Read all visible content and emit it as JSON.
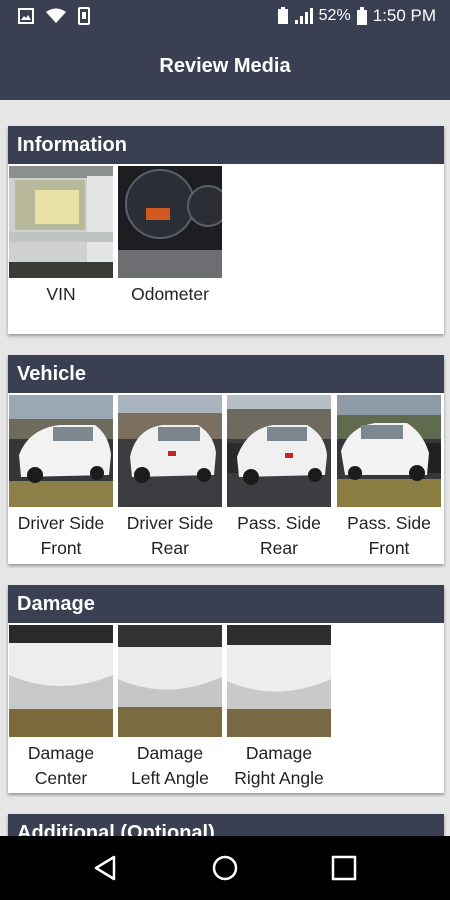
{
  "status_bar": {
    "battery": "52%",
    "time": "1:50 PM"
  },
  "app_bar": {
    "title": "Review Media"
  },
  "sections": [
    {
      "title": "Information",
      "items": [
        {
          "line1": "VIN",
          "line2": ""
        },
        {
          "line1": "Odometer",
          "line2": ""
        }
      ]
    },
    {
      "title": "Vehicle",
      "items": [
        {
          "line1": "Driver Side",
          "line2": "Front"
        },
        {
          "line1": "Driver Side",
          "line2": "Rear"
        },
        {
          "line1": "Pass. Side",
          "line2": "Rear"
        },
        {
          "line1": "Pass. Side",
          "line2": "Front"
        }
      ]
    },
    {
      "title": "Damage",
      "items": [
        {
          "line1": "Damage",
          "line2": "Center"
        },
        {
          "line1": "Damage",
          "line2": "Left Angle"
        },
        {
          "line1": "Damage",
          "line2": "Right Angle"
        }
      ]
    },
    {
      "title": "Additional (Optional)",
      "items": []
    }
  ],
  "colors": {
    "header": "#3b3f52",
    "background": "#e6e6e6",
    "card": "#ffffff"
  }
}
